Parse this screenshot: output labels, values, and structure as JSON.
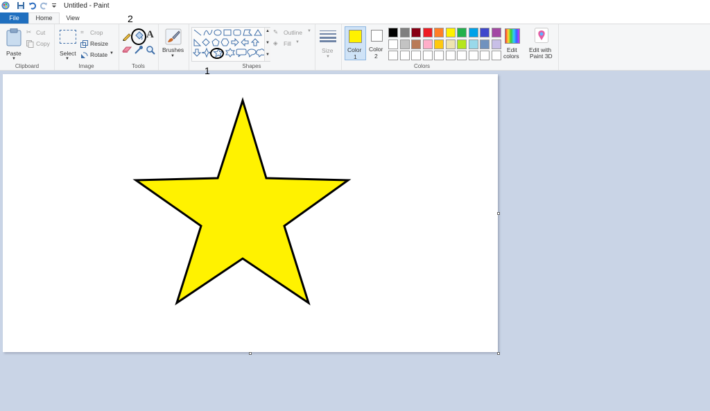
{
  "window": {
    "title": "Untitled - Paint"
  },
  "tabs": {
    "file": "File",
    "home": "Home",
    "view": "View"
  },
  "clipboard": {
    "paste": "Paste",
    "cut": "Cut",
    "copy": "Copy",
    "group": "Clipboard"
  },
  "image": {
    "select": "Select",
    "crop": "Crop",
    "resize": "Resize",
    "rotate": "Rotate",
    "group": "Image"
  },
  "tools": {
    "group": "Tools",
    "text_tool": "A"
  },
  "brushes": {
    "label": "Brushes"
  },
  "shapes": {
    "outline": "Outline",
    "fill": "Fill",
    "group": "Shapes"
  },
  "size": {
    "label": "Size"
  },
  "colors": {
    "color1_label": "Color\n1",
    "color1_line1": "Color",
    "color1_line2": "1",
    "color2_line1": "Color",
    "color2_line2": "2",
    "edit_colors_line1": "Edit",
    "edit_colors_line2": "colors",
    "paint3d_line1": "Edit with",
    "paint3d_line2": "Paint 3D",
    "group": "Colors",
    "color1_value": "#fff200",
    "color2_value": "#ffffff",
    "palette_row1": [
      "#000000",
      "#7f7f7f",
      "#880015",
      "#ed1c24",
      "#ff7f27",
      "#fff200",
      "#22b14c",
      "#00a2e8",
      "#3f48cc",
      "#a349a4"
    ],
    "palette_row2": [
      "#ffffff",
      "#c3c3c3",
      "#b97a57",
      "#ffaec9",
      "#ffc90e",
      "#efe4b0",
      "#b5e61d",
      "#99d9ea",
      "#7092be",
      "#c8bfe7"
    ],
    "palette_row3": [
      "#ffffff",
      "#ffffff",
      "#ffffff",
      "#ffffff",
      "#ffffff",
      "#ffffff",
      "#ffffff",
      "#ffffff",
      "#ffffff",
      "#ffffff"
    ]
  },
  "drawing": {
    "shape": "star",
    "fill": "#fff200",
    "stroke": "#000000"
  },
  "annotations": {
    "one": "1",
    "two": "2"
  }
}
